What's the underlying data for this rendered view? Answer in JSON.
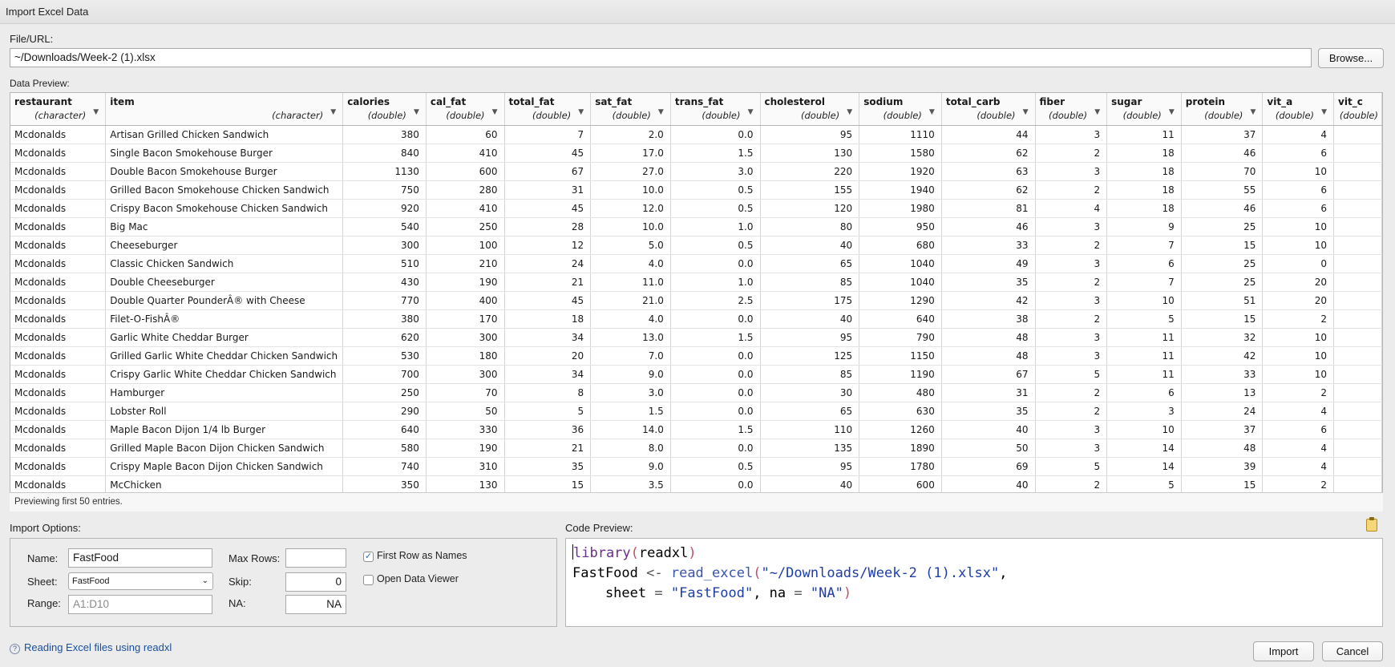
{
  "window": {
    "title": "Import Excel Data"
  },
  "file": {
    "label": "File/URL:",
    "value": "~/Downloads/Week-2 (1).xlsx",
    "browse_label": "Browse..."
  },
  "preview": {
    "label": "Data Preview:",
    "footer": "Previewing first 50 entries.",
    "columns": [
      {
        "name": "restaurant",
        "type": "(character)"
      },
      {
        "name": "item",
        "type": "(character)"
      },
      {
        "name": "calories",
        "type": "(double)"
      },
      {
        "name": "cal_fat",
        "type": "(double)"
      },
      {
        "name": "total_fat",
        "type": "(double)"
      },
      {
        "name": "sat_fat",
        "type": "(double)"
      },
      {
        "name": "trans_fat",
        "type": "(double)"
      },
      {
        "name": "cholesterol",
        "type": "(double)"
      },
      {
        "name": "sodium",
        "type": "(double)"
      },
      {
        "name": "total_carb",
        "type": "(double)"
      },
      {
        "name": "fiber",
        "type": "(double)"
      },
      {
        "name": "sugar",
        "type": "(double)"
      },
      {
        "name": "protein",
        "type": "(double)"
      },
      {
        "name": "vit_a",
        "type": "(double)"
      },
      {
        "name": "vit_c",
        "type": "(double)"
      }
    ],
    "rows": [
      [
        "Mcdonalds",
        "Artisan Grilled Chicken Sandwich",
        "380",
        "60",
        "7",
        "2.0",
        "0.0",
        "95",
        "1110",
        "44",
        "3",
        "11",
        "37",
        "4",
        ""
      ],
      [
        "Mcdonalds",
        "Single Bacon Smokehouse Burger",
        "840",
        "410",
        "45",
        "17.0",
        "1.5",
        "130",
        "1580",
        "62",
        "2",
        "18",
        "46",
        "6",
        ""
      ],
      [
        "Mcdonalds",
        "Double Bacon Smokehouse Burger",
        "1130",
        "600",
        "67",
        "27.0",
        "3.0",
        "220",
        "1920",
        "63",
        "3",
        "18",
        "70",
        "10",
        ""
      ],
      [
        "Mcdonalds",
        "Grilled Bacon Smokehouse Chicken Sandwich",
        "750",
        "280",
        "31",
        "10.0",
        "0.5",
        "155",
        "1940",
        "62",
        "2",
        "18",
        "55",
        "6",
        ""
      ],
      [
        "Mcdonalds",
        "Crispy Bacon Smokehouse Chicken Sandwich",
        "920",
        "410",
        "45",
        "12.0",
        "0.5",
        "120",
        "1980",
        "81",
        "4",
        "18",
        "46",
        "6",
        ""
      ],
      [
        "Mcdonalds",
        "Big Mac",
        "540",
        "250",
        "28",
        "10.0",
        "1.0",
        "80",
        "950",
        "46",
        "3",
        "9",
        "25",
        "10",
        ""
      ],
      [
        "Mcdonalds",
        "Cheeseburger",
        "300",
        "100",
        "12",
        "5.0",
        "0.5",
        "40",
        "680",
        "33",
        "2",
        "7",
        "15",
        "10",
        ""
      ],
      [
        "Mcdonalds",
        "Classic Chicken Sandwich",
        "510",
        "210",
        "24",
        "4.0",
        "0.0",
        "65",
        "1040",
        "49",
        "3",
        "6",
        "25",
        "0",
        ""
      ],
      [
        "Mcdonalds",
        "Double Cheeseburger",
        "430",
        "190",
        "21",
        "11.0",
        "1.0",
        "85",
        "1040",
        "35",
        "2",
        "7",
        "25",
        "20",
        ""
      ],
      [
        "Mcdonalds",
        "Double Quarter PounderÂ® with Cheese",
        "770",
        "400",
        "45",
        "21.0",
        "2.5",
        "175",
        "1290",
        "42",
        "3",
        "10",
        "51",
        "20",
        ""
      ],
      [
        "Mcdonalds",
        "Filet-O-FishÂ®",
        "380",
        "170",
        "18",
        "4.0",
        "0.0",
        "40",
        "640",
        "38",
        "2",
        "5",
        "15",
        "2",
        ""
      ],
      [
        "Mcdonalds",
        "Garlic White Cheddar Burger",
        "620",
        "300",
        "34",
        "13.0",
        "1.5",
        "95",
        "790",
        "48",
        "3",
        "11",
        "32",
        "10",
        ""
      ],
      [
        "Mcdonalds",
        "Grilled Garlic White Cheddar Chicken Sandwich",
        "530",
        "180",
        "20",
        "7.0",
        "0.0",
        "125",
        "1150",
        "48",
        "3",
        "11",
        "42",
        "10",
        ""
      ],
      [
        "Mcdonalds",
        "Crispy Garlic White Cheddar Chicken Sandwich",
        "700",
        "300",
        "34",
        "9.0",
        "0.0",
        "85",
        "1190",
        "67",
        "5",
        "11",
        "33",
        "10",
        ""
      ],
      [
        "Mcdonalds",
        "Hamburger",
        "250",
        "70",
        "8",
        "3.0",
        "0.0",
        "30",
        "480",
        "31",
        "2",
        "6",
        "13",
        "2",
        ""
      ],
      [
        "Mcdonalds",
        "Lobster Roll",
        "290",
        "50",
        "5",
        "1.5",
        "0.0",
        "65",
        "630",
        "35",
        "2",
        "3",
        "24",
        "4",
        ""
      ],
      [
        "Mcdonalds",
        "Maple Bacon Dijon 1/4 lb Burger",
        "640",
        "330",
        "36",
        "14.0",
        "1.5",
        "110",
        "1260",
        "40",
        "3",
        "10",
        "37",
        "6",
        ""
      ],
      [
        "Mcdonalds",
        "Grilled Maple Bacon Dijon Chicken Sandwich",
        "580",
        "190",
        "21",
        "8.0",
        "0.0",
        "135",
        "1890",
        "50",
        "3",
        "14",
        "48",
        "4",
        ""
      ],
      [
        "Mcdonalds",
        "Crispy Maple Bacon Dijon Chicken Sandwich",
        "740",
        "310",
        "35",
        "9.0",
        "0.5",
        "95",
        "1780",
        "69",
        "5",
        "14",
        "39",
        "4",
        ""
      ],
      [
        "Mcdonalds",
        "McChicken",
        "350",
        "130",
        "15",
        "3.5",
        "0.0",
        "40",
        "600",
        "40",
        "2",
        "5",
        "15",
        "2",
        ""
      ]
    ]
  },
  "options": {
    "label": "Import Options:",
    "name_label": "Name:",
    "name_value": "FastFood",
    "sheet_label": "Sheet:",
    "sheet_value": "FastFood",
    "range_label": "Range:",
    "range_placeholder": "A1:D10",
    "maxrows_label": "Max Rows:",
    "maxrows_value": "",
    "skip_label": "Skip:",
    "skip_value": "0",
    "na_label": "NA:",
    "na_value": "NA",
    "first_row_label": "First Row as Names",
    "first_row_checked": "✓",
    "open_viewer_label": "Open Data Viewer"
  },
  "code": {
    "label": "Code Preview:",
    "l1_fn": "library",
    "l1_open": "(",
    "l1_arg": "readxl",
    "l1_close": ")",
    "l2_var": "FastFood ",
    "l2_op": "<-",
    "l2_call": " read_excel",
    "l2_open": "(",
    "l2_str": "\"~/Downloads/Week-2 (1).xlsx\"",
    "l2_comma": ",",
    "l3_indent": "    sheet ",
    "l3_eq1": "=",
    "l3_sheet": " \"FastFood\"",
    "l3_mid": ", na ",
    "l3_eq2": "=",
    "l3_na": " \"NA\"",
    "l3_close": ")"
  },
  "footer": {
    "help_link": "Reading Excel files using readxl",
    "import_label": "Import",
    "cancel_label": "Cancel"
  }
}
